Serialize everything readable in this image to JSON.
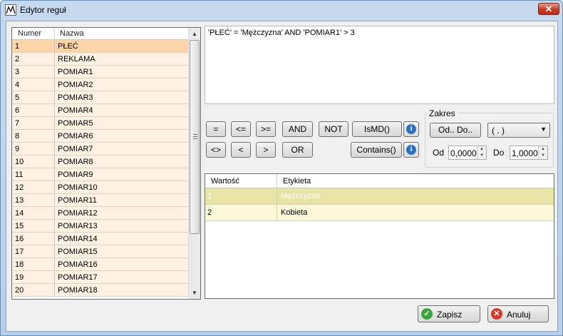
{
  "window": {
    "title": "Edytor reguł",
    "close_label": "✕"
  },
  "left_grid": {
    "headers": [
      "Numer",
      "Nazwa"
    ],
    "rows": [
      [
        "1",
        "PŁEĆ"
      ],
      [
        "2",
        "REKLAMA"
      ],
      [
        "3",
        "POMIAR1"
      ],
      [
        "4",
        "POMIAR2"
      ],
      [
        "5",
        "POMIAR3"
      ],
      [
        "6",
        "POMIAR4"
      ],
      [
        "7",
        "POMIAR5"
      ],
      [
        "8",
        "POMIAR6"
      ],
      [
        "9",
        "POMIAR7"
      ],
      [
        "10",
        "POMIAR8"
      ],
      [
        "11",
        "POMIAR9"
      ],
      [
        "12",
        "POMIAR10"
      ],
      [
        "13",
        "POMIAR11"
      ],
      [
        "14",
        "POMIAR12"
      ],
      [
        "15",
        "POMIAR13"
      ],
      [
        "16",
        "POMIAR14"
      ],
      [
        "17",
        "POMIAR15"
      ],
      [
        "18",
        "POMIAR16"
      ],
      [
        "19",
        "POMIAR17"
      ],
      [
        "20",
        "POMIAR18"
      ]
    ]
  },
  "expression": "'PŁEĆ' = 'Mężczyzna' AND 'POMIAR1' > 3",
  "operators": {
    "eq": "=",
    "le": "<=",
    "ge": ">=",
    "and": "AND",
    "not": "NOT",
    "ismd": "IsMD()",
    "ne": "<>",
    "lt": "<",
    "gt": ">",
    "or": "OR",
    "contains": "Contains()"
  },
  "info_icon": "i",
  "range": {
    "group_label": "Zakres",
    "odo_button": "Od.. Do..",
    "combo_value": "( . )",
    "from_label": "Od",
    "from_value": "0,0000",
    "to_label": "Do",
    "to_value": "1,0000"
  },
  "values_grid": {
    "headers": [
      "Wartość",
      "Etykieta"
    ],
    "rows": [
      [
        "1",
        "Mężczyzna"
      ],
      [
        "2",
        "Kobieta"
      ]
    ]
  },
  "footer": {
    "save_label": "Zapisz",
    "cancel_label": "Anuluj"
  },
  "colors": {
    "selected_row": "#fbd5a9",
    "row_bg": "#fdf1e4",
    "value_row": "#fbf9d9"
  }
}
